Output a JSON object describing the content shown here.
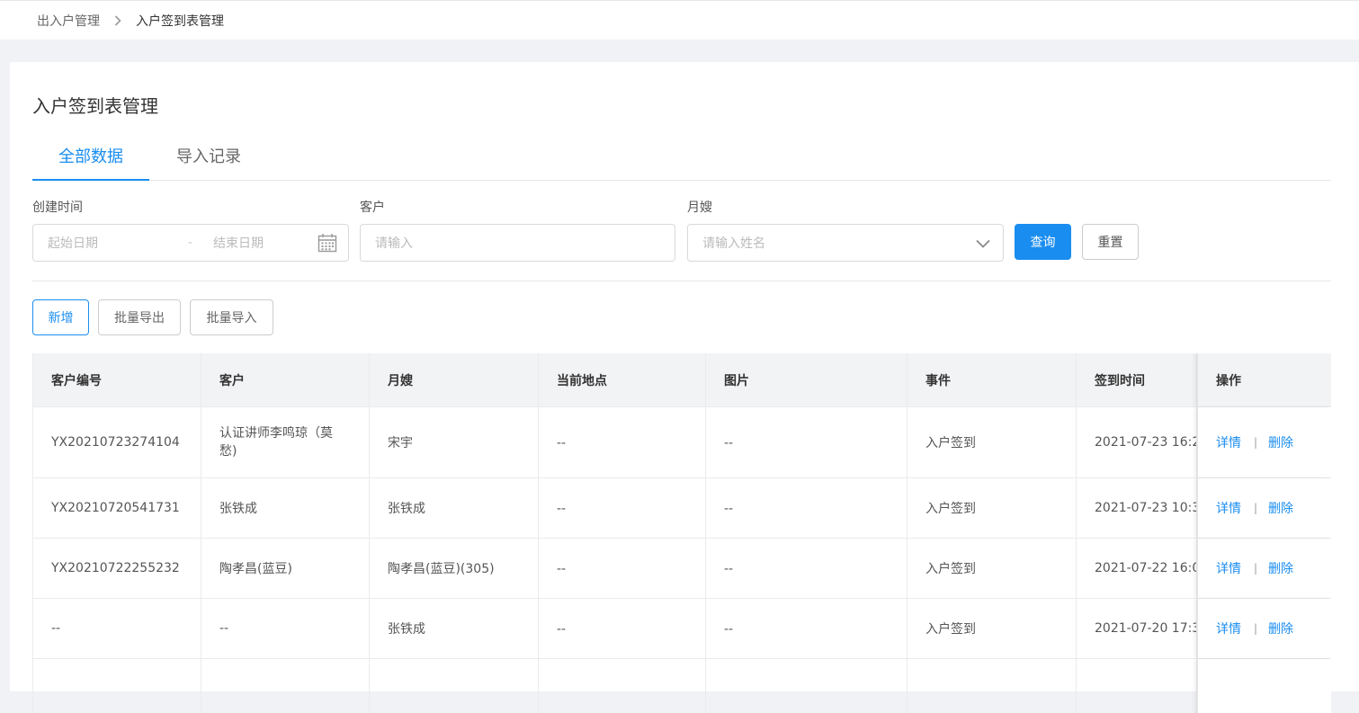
{
  "breadcrumb": {
    "parent": "出入户管理",
    "current": "入户签到表管理"
  },
  "page_title": "入户签到表管理",
  "tabs": [
    {
      "label": "全部数据"
    },
    {
      "label": "导入记录"
    }
  ],
  "filters": {
    "created_time_label": "创建时间",
    "start_placeholder": "起始日期",
    "range_separator": "-",
    "end_placeholder": "结束日期",
    "customer_label": "客户",
    "customer_placeholder": "请输入",
    "nanny_label": "月嫂",
    "nanny_placeholder": "请输入姓名",
    "query_button": "查询",
    "reset_button": "重置"
  },
  "actions": {
    "add": "新增",
    "batch_export": "批量导出",
    "batch_import": "批量导入"
  },
  "table": {
    "columns": [
      "客户编号",
      "客户",
      "月嫂",
      "当前地点",
      "图片",
      "事件",
      "签到时间",
      "操作"
    ],
    "rows": [
      {
        "id": "YX20210723274104",
        "customer": "认证讲师李鸣琼（莫愁)",
        "nanny": "宋宇",
        "location": "--",
        "image": "--",
        "event": "入户签到",
        "time": "2021-07-23 16:2",
        "detail": "详情",
        "delete": "删除"
      },
      {
        "id": "YX20210720541731",
        "customer": "张铁成",
        "nanny": "张铁成",
        "location": "--",
        "image": "--",
        "event": "入户签到",
        "time": "2021-07-23 10:3",
        "detail": "详情",
        "delete": "删除"
      },
      {
        "id": "YX20210722255232",
        "customer": "陶孝昌(蓝豆)",
        "nanny": "陶孝昌(蓝豆)(305)",
        "location": "--",
        "image": "--",
        "event": "入户签到",
        "time": "2021-07-22 16:0",
        "detail": "详情",
        "delete": "删除"
      },
      {
        "id": "--",
        "customer": "--",
        "nanny": "张铁成",
        "location": "--",
        "image": "--",
        "event": "入户签到",
        "time": "2021-07-20 17:3",
        "detail": "详情",
        "delete": "删除"
      }
    ],
    "op_separator": "|"
  },
  "icons": {
    "breadcrumb_separator": "chevron-right-icon",
    "date": "calendar-icon",
    "select": "chevron-down-icon"
  },
  "colors": {
    "accent": "#1a8df0",
    "header_bg": "#f2f3f5",
    "page_bg": "#f0f2f5"
  }
}
